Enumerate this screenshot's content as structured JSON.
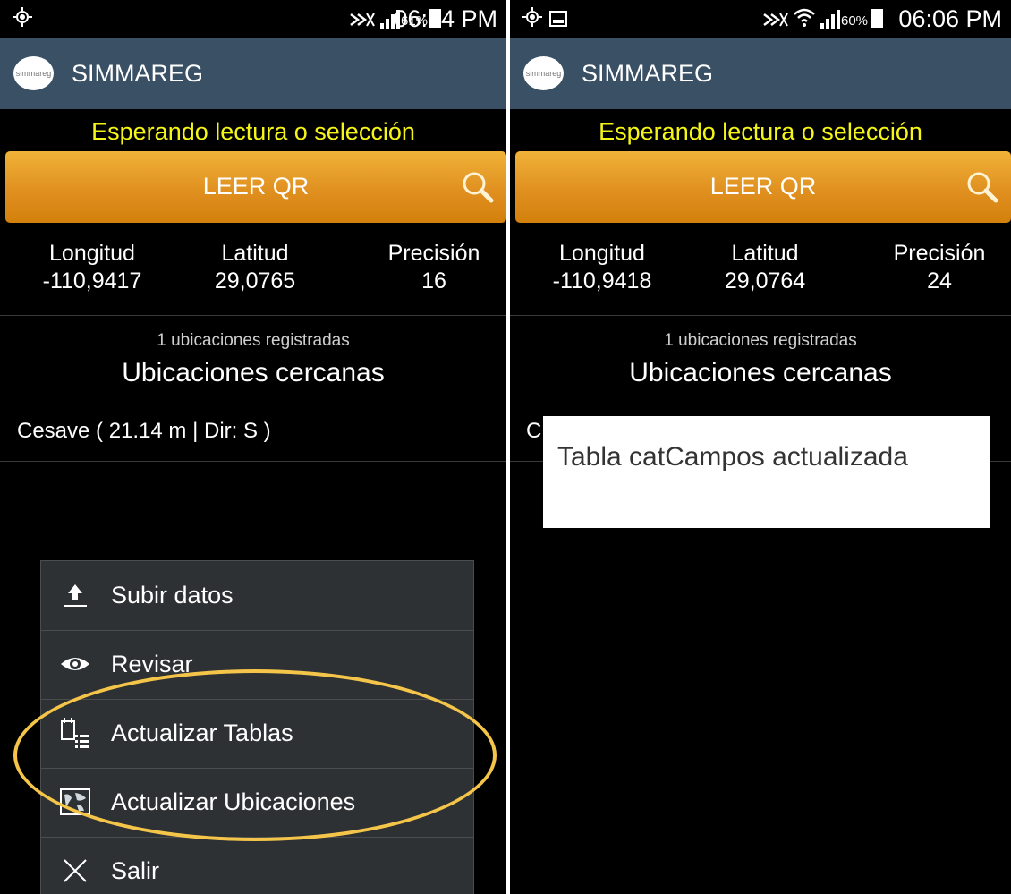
{
  "left": {
    "status_time": "06:04 PM",
    "battery_pct": "61%",
    "app_title": "SIMMAREG",
    "logo_text": "simmareg",
    "status_message": "Esperando lectura o selección",
    "read_button": "LEER QR",
    "coords": [
      {
        "label": "Longitud",
        "value": "-110,9417"
      },
      {
        "label": "Latitud",
        "value": "29,0765"
      },
      {
        "label": "Precisión",
        "value": "16"
      }
    ],
    "registered_count": "1 ubicaciones registradas",
    "nearby_title": "Ubicaciones cercanas",
    "location_item": "Cesave ( 21.14 m | Dir: S )",
    "menu": [
      {
        "label": "Subir datos",
        "icon": "upload-icon"
      },
      {
        "label": "Revisar",
        "icon": "eye-icon"
      },
      {
        "label": "Actualizar Tablas",
        "icon": "table-update-icon"
      },
      {
        "label": "Actualizar Ubicaciones",
        "icon": "map-update-icon"
      },
      {
        "label": "Salir",
        "icon": "close-icon"
      }
    ]
  },
  "right": {
    "status_time": "06:06 PM",
    "battery_pct": "60%",
    "app_title": "SIMMAREG",
    "logo_text": "simmareg",
    "status_message": "Esperando lectura o selección",
    "read_button": "LEER QR",
    "coords": [
      {
        "label": "Longitud",
        "value": "-110,9418"
      },
      {
        "label": "Latitud",
        "value": "29,0764"
      },
      {
        "label": "Precisión",
        "value": "24"
      }
    ],
    "registered_count": "1 ubicaciones registradas",
    "nearby_title": "Ubicaciones cercanas",
    "location_item_partial": "C",
    "toast": "Tabla catCampos actualizada"
  },
  "colors": {
    "appbar": "#3a5065",
    "button_orange": "#e09020",
    "status_yellow": "#f5f517",
    "highlight_oval": "#f5c54a",
    "menu_bg": "#2e3134"
  }
}
